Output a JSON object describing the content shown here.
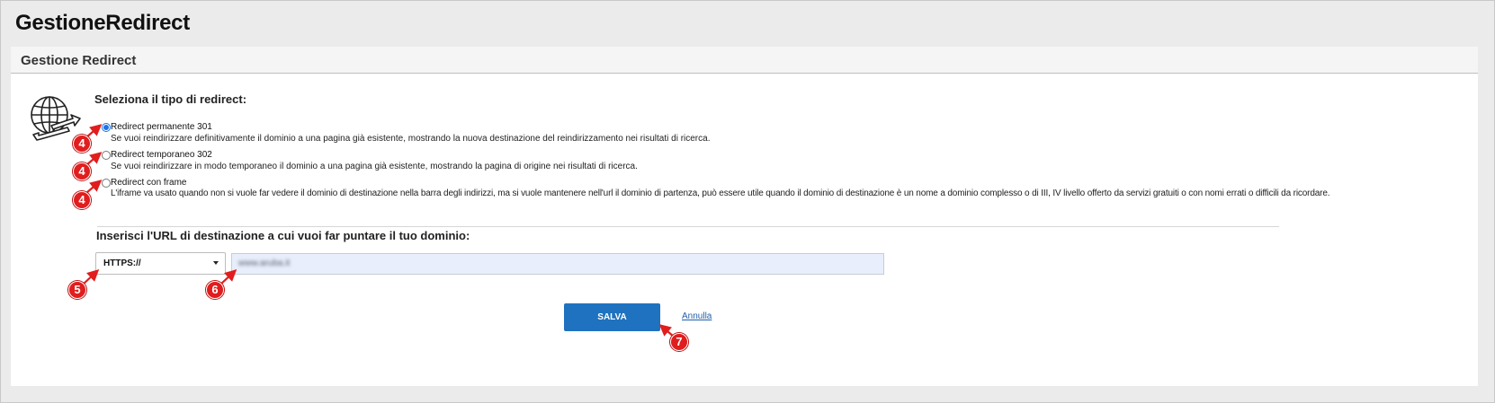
{
  "app": {
    "title": "GestioneRedirect"
  },
  "panel": {
    "title": "Gestione Redirect"
  },
  "redirect_type": {
    "label": "Seleziona il tipo di redirect:",
    "options": [
      {
        "title": "Redirect permanente 301",
        "description": "Se vuoi reindirizzare definitivamente il dominio a una pagina già esistente, mostrando la nuova destinazione del reindirizzamento nei risultati di ricerca.",
        "selected": true
      },
      {
        "title": "Redirect temporaneo 302",
        "description": "Se vuoi reindirizzare in modo temporaneo il dominio a una pagina già esistente, mostrando la pagina di origine nei risultati di ricerca.",
        "selected": false
      },
      {
        "title": "Redirect con frame",
        "description": "L'iframe va usato quando non si vuole far vedere il dominio di destinazione nella barra degli indirizzi, ma si vuole mantenere nell'url il dominio di partenza, può essere utile quando il dominio di destinazione è un nome a dominio complesso o di III, IV livello offerto da servizi gratuiti o con nomi errati o difficili da ricordare.",
        "selected": false
      }
    ]
  },
  "destination": {
    "label": "Inserisci l'URL di destinazione a cui vuoi far puntare il tuo dominio:",
    "protocol_selected": "HTTPS://",
    "url_value": "www.aruba.it"
  },
  "actions": {
    "save_label": "SALVA",
    "cancel_label": "Annulla"
  },
  "annotations": {
    "badge_4": "4",
    "badge_5": "5",
    "badge_6": "6",
    "badge_7": "7",
    "color": "#e11d1d"
  },
  "colors": {
    "primary_button": "#1f72bf",
    "link": "#1f5fa8",
    "input_bg": "#e8eefb"
  },
  "icons": {
    "globe": "globe-redirect-icon",
    "select": "chevron-down-icon"
  }
}
